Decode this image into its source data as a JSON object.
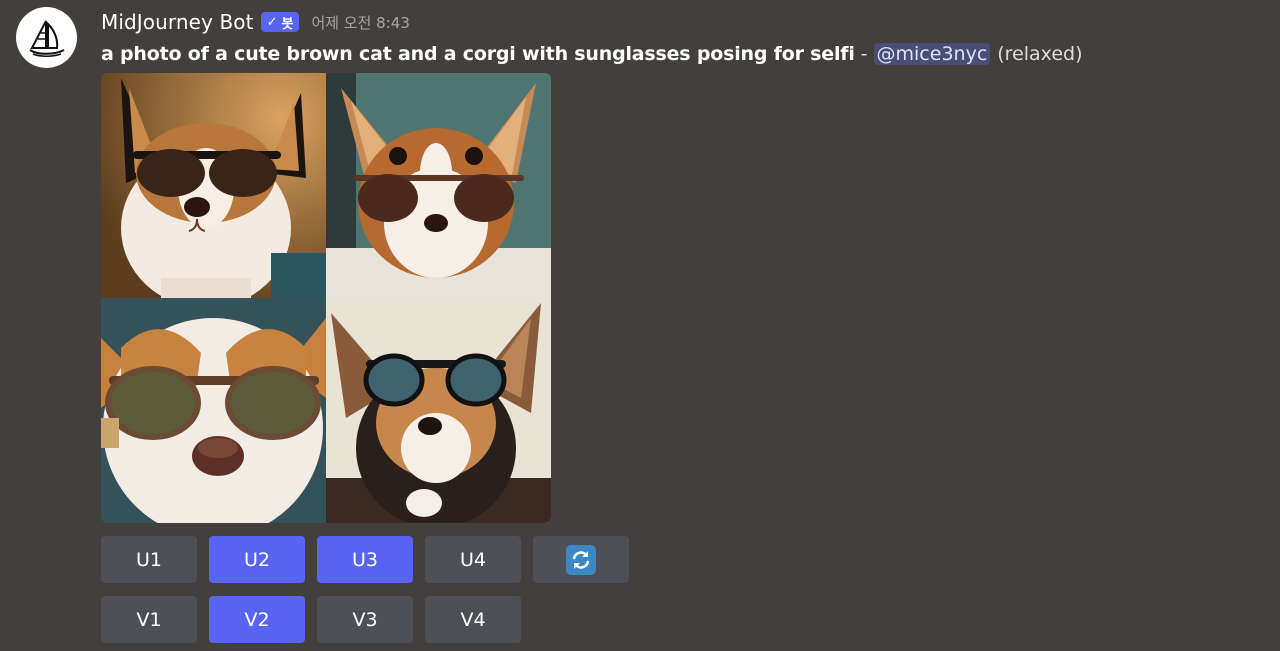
{
  "message": {
    "author": "MidJourney Bot",
    "bot_tag": "봇",
    "bot_tag_check": "✓",
    "timestamp": "어제 오전 8:43",
    "prompt": "a photo of a cute brown cat and a corgi with sunglasses posing for selfi",
    "separator": "-",
    "mention": "@mice3nyc",
    "mode": "(relaxed)"
  },
  "image_grid": {
    "tiles": [
      {
        "subject": "corgi-with-dark-sunglasses-1"
      },
      {
        "subject": "corgi-with-brown-sunglasses-2"
      },
      {
        "subject": "corgi-with-olive-sunglasses-3"
      },
      {
        "subject": "corgi-with-blue-sunglasses-4"
      }
    ]
  },
  "buttons": {
    "upscale": [
      {
        "label": "U1",
        "active": false
      },
      {
        "label": "U2",
        "active": true
      },
      {
        "label": "U3",
        "active": true
      },
      {
        "label": "U4",
        "active": false
      }
    ],
    "reroll": {
      "icon": "reroll-icon"
    },
    "variation": [
      {
        "label": "V1",
        "active": false
      },
      {
        "label": "V2",
        "active": true
      },
      {
        "label": "V3",
        "active": false
      },
      {
        "label": "V4",
        "active": false
      }
    ]
  },
  "colors": {
    "background": "#423f3d",
    "blurple": "#5865f2",
    "button_grey": "#4e5058",
    "mention_bg": "#4a4e75"
  }
}
